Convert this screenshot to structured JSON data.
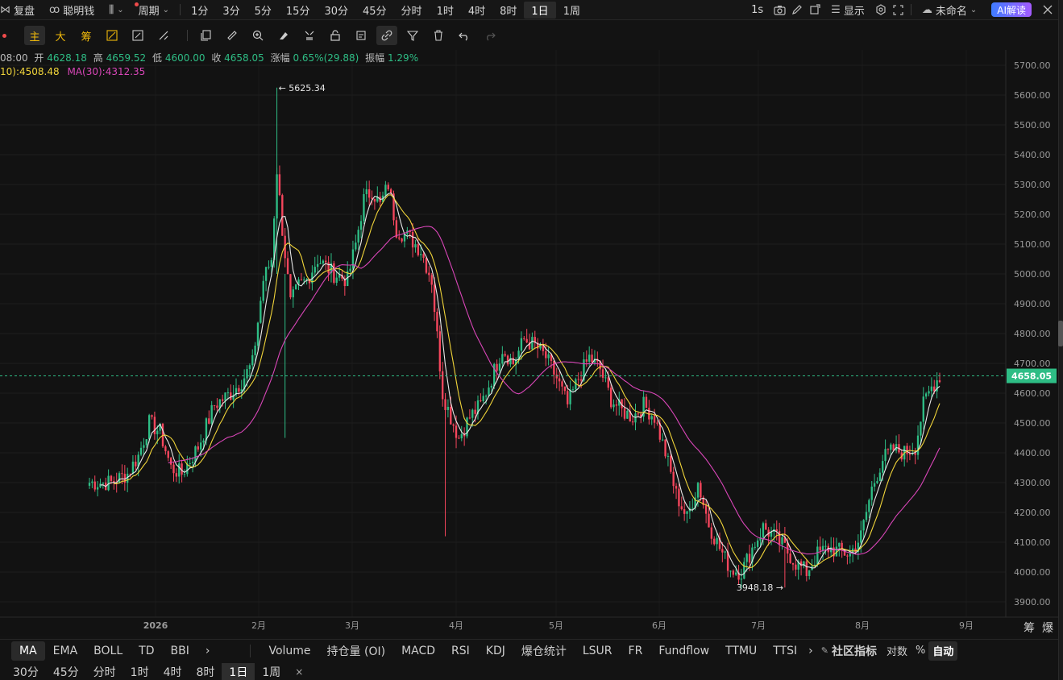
{
  "top_bar": {
    "items": [
      "复盘",
      "聪明钱",
      "周期",
      "1分",
      "3分",
      "5分",
      "15分",
      "30分",
      "45分",
      "分时",
      "1时",
      "4时",
      "8时",
      "1日",
      "1周"
    ],
    "active": "1日",
    "refresh": "1s",
    "display_label": "显示",
    "layout_name": "未命名",
    "ai_label": "AI解读"
  },
  "draw_bar": {
    "main_label": "主",
    "big_label": "大",
    "chip_label": "筹"
  },
  "info": {
    "time": "08:00",
    "open_label": "开",
    "open": "4628.18",
    "high_label": "高",
    "high": "4659.52",
    "low_label": "低",
    "low": "4600.00",
    "close_label": "收",
    "close": "4658.05",
    "change_label": "涨幅",
    "change": "0.65%(29.88)",
    "amp_label": "振幅",
    "amp": "1.29%",
    "ma10": "10):4508.48",
    "ma30": "MA(30):4312.35"
  },
  "chart_data": {
    "type": "candlestick",
    "y_axis": [
      "5700.00",
      "5600.00",
      "5500.00",
      "5400.00",
      "5300.00",
      "5200.00",
      "5100.00",
      "5000.00",
      "4900.00",
      "4800.00",
      "4700.00",
      "4600.00",
      "4500.00",
      "4400.00",
      "4300.00",
      "4200.00",
      "4100.00",
      "4000.00",
      "3900.00"
    ],
    "ylim": [
      3860,
      5760
    ],
    "x_axis": [
      "2026",
      "2月",
      "3月",
      "4月",
      "5月",
      "6月",
      "7月",
      "8月",
      "9月"
    ],
    "current_price": "4658.05",
    "max_label": "← 5625.34",
    "min_label": "3948.18 →",
    "corner_labels": [
      "筹",
      "爆"
    ],
    "colors": {
      "up": "#2ebd85",
      "down": "#f6465d",
      "ma5": "#e8e8e8",
      "ma10": "#f0d43a",
      "ma30": "#d946b8",
      "current": "#2ebd85"
    }
  },
  "indicator_bar": {
    "main": [
      "MA",
      "EMA",
      "BOLL",
      "TD",
      "BBI"
    ],
    "active": "MA",
    "sub": [
      "Volume",
      "持仓量 (OI)",
      "MACD",
      "RSI",
      "KDJ",
      "爆仓统计",
      "LSUR",
      "FR",
      "Fundflow",
      "TTMU",
      "TTSI"
    ],
    "community": "社区指标",
    "log": "对数",
    "pct": "%",
    "auto": "自动"
  },
  "tf_bar": {
    "items": [
      "30分",
      "45分",
      "分时",
      "1时",
      "4时",
      "8时",
      "1日",
      "1周"
    ],
    "active": "1日",
    "close": "×"
  }
}
